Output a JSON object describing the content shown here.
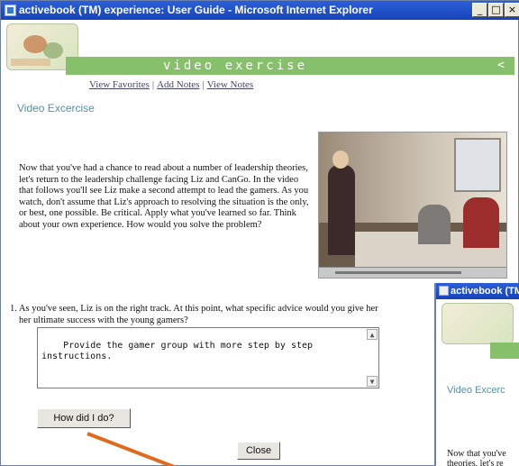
{
  "window": {
    "title": "activebook (TM) experience: User Guide - Microsoft Internet Explorer",
    "controls": {
      "minimize": "_",
      "maximize": "□",
      "close": "×"
    }
  },
  "banner": {
    "title": "video exercise",
    "arrow": "<"
  },
  "links": {
    "favorites": "View Favorites",
    "add_notes": "Add Notes",
    "view_notes": "View Notes",
    "separator": "|"
  },
  "section_title": "Video Excercise",
  "intro": "Now that you've had a chance to read about a number of leadership theories, let's return to the leadership challenge facing Liz and CanGo. In the video that follows you'll see Liz make a second attempt to lead the gamers. As you watch, don't assume that Liz's approach to resolving the situation is the only, or best, one possible. Be critical. Apply what you've learned so far. Think about your own experience. How would you solve the problem?",
  "question": {
    "line1": "1. As you've seen, Liz is on the right track. At this point, what specific advice would you give her",
    "line2": "her ultimate success with the young gamers?"
  },
  "answer": {
    "value": "Provide the gamer group with more step by step\ninstructions."
  },
  "buttons": {
    "how_did_i_do": "How did I do?",
    "close": "Close"
  },
  "second_window": {
    "title": "activebook (TM)",
    "section_title": "Video Excerc",
    "intro_line1": "Now that you've",
    "intro_line2": "theories, let's re"
  },
  "colors": {
    "banner": "#86c06a",
    "titlebar": "#1f4fc8",
    "section_title": "#5b8fa0",
    "pointer": "#e06a1e"
  }
}
